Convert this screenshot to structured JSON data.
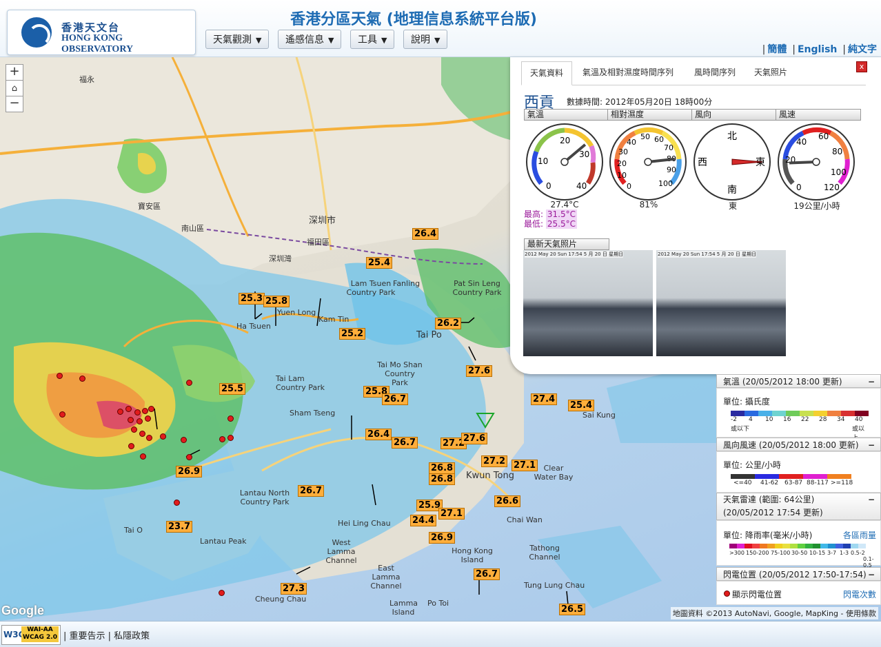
{
  "header": {
    "logo_zh": "香港天文台",
    "logo_en": "HONG KONG OBSERVATORY",
    "title": "香港分區天氣 (地理信息系統平台版)",
    "menus": [
      "天氣觀測",
      "遙感信息",
      "工具",
      "說明"
    ],
    "lang": [
      "簡體",
      "English",
      "純文字"
    ]
  },
  "map": {
    "zoom_in": "+",
    "zoom_out": "−",
    "places": [
      {
        "name": "福永",
        "big": false
      },
      {
        "name": "深圳市",
        "big": true
      },
      {
        "name": "福田區",
        "big": false
      },
      {
        "name": "南山區",
        "big": false
      },
      {
        "name": "寶安區",
        "big": false
      },
      {
        "name": "深圳灣",
        "big": false
      },
      {
        "name": "Tai Po",
        "big": false
      },
      {
        "name": "Fanling",
        "big": false
      },
      {
        "name": "Kwun Tong",
        "big": true
      },
      {
        "name": "Hong Kong Island",
        "big": false
      },
      {
        "name": "Lantau Peak",
        "big": false
      },
      {
        "name": "Tai O",
        "big": false
      },
      {
        "name": "Chai Wan",
        "big": false
      },
      {
        "name": "Sai Kung",
        "big": false
      },
      {
        "name": "Lamma Island",
        "big": false
      },
      {
        "name": "Clear Water Bay",
        "big": false
      },
      {
        "name": "Ha Tsuen",
        "big": false
      },
      {
        "name": "Kam Tin",
        "big": false
      },
      {
        "name": "Yuen Long",
        "big": false
      },
      {
        "name": "Tai Lam Country Park",
        "big": false
      },
      {
        "name": "Sham Tseng",
        "big": false
      },
      {
        "name": "Lam Tsuen Country Park",
        "big": false
      },
      {
        "name": "Tai Mo Shan Country Park",
        "big": false
      },
      {
        "name": "Pat Sin Leng Country Park",
        "big": false
      },
      {
        "name": "West Lamma Channel",
        "big": false
      },
      {
        "name": "East Lamma Channel",
        "big": false
      },
      {
        "name": "Lantau North Country Park",
        "big": false
      },
      {
        "name": "Tathong Channel",
        "big": false
      },
      {
        "name": "Hei Ling Chau",
        "big": false
      },
      {
        "name": "Po Toi",
        "big": false
      },
      {
        "name": "Tung Lung Chau",
        "big": false
      },
      {
        "name": "Cheung Chau",
        "big": false
      }
    ],
    "temperatures": [
      "26.4",
      "25.4",
      "25.3",
      "25.8",
      "25.2",
      "26.2",
      "27.6",
      "25.5",
      "25.8",
      "26.7",
      "27.4",
      "25.4",
      "26.4",
      "26.7",
      "27.2",
      "27.6",
      "26.8",
      "26.8",
      "27.2",
      "27.1",
      "26.9",
      "26.7",
      "25.9",
      "24.4",
      "27.1",
      "26.6",
      "26.9",
      "23.7",
      "26.7",
      "27.3",
      "26.5"
    ],
    "google": "Google",
    "credit": "地圖資料 ©2013 AutoNavi, Google, MapKing - 使用條款"
  },
  "info": {
    "tabs": [
      "天氣資料",
      "氣溫及相對濕度時間序列",
      "風時間序列",
      "天氣照片"
    ],
    "close": "x",
    "station": "西貢",
    "data_time": "數據時間: 2012年05月20日 18時00分",
    "gauges": [
      {
        "title": "氣溫",
        "value": "27.4°C",
        "ticks": [
          "0",
          "10",
          "20",
          "30",
          "40"
        ]
      },
      {
        "title": "相對濕度",
        "value": "81%",
        "ticks": [
          "0",
          "10",
          "20",
          "30",
          "40",
          "50",
          "60",
          "70",
          "80",
          "90",
          "100"
        ]
      },
      {
        "title": "風向",
        "value": "東",
        "ticks": [
          "北",
          "西",
          "東",
          "南"
        ]
      },
      {
        "title": "風速",
        "value": "19公里/小時",
        "ticks": [
          "0",
          "20",
          "40",
          "60",
          "80",
          "100",
          "120"
        ]
      }
    ],
    "temp_value": 27.4,
    "rh_value": 81,
    "wind_dir_deg": 90,
    "wind_speed_value": 19,
    "max_label": "最高:",
    "max_value": "31.5°C",
    "min_label": "最低:",
    "min_value": "25.5°C",
    "photo_title": "最新天氣照片",
    "photo_stamp": "2012 May 20 Sun 17:54 5 月 20 日 星期日"
  },
  "legend": {
    "temp_title": "氣溫 (20/05/2012 18:00 更新)",
    "temp_unit": "單位: 攝氏度",
    "temp_ticks": [
      "-2",
      "4",
      "10",
      "16",
      "22",
      "28",
      "34",
      "40"
    ],
    "temp_low": "或以下",
    "temp_high": "或以上",
    "wind_title": "風向風速 (20/05/2012 18:00 更新)",
    "wind_unit": "單位: 公里/小時",
    "wind_ticks": [
      "<=40",
      "41-62",
      "63-87",
      "88-117",
      ">=118"
    ],
    "radar_title": "天氣雷達 (範圍: 64公里)",
    "radar_time": "(20/05/2012 17:54 更新)",
    "radar_unit": "單位: 降雨率(毫米/小時)",
    "radar_link": "各區雨量",
    "radar_ticks": [
      ">300",
      "150-200",
      "75-100",
      "30-50",
      "10-15",
      "3-7",
      "1-3",
      "0.5-2",
      "0.1-0.5"
    ],
    "lightning_title": "閃電位置 (20/05/2012 17:50-17:54)",
    "lightning_show": "顯示閃電位置",
    "lightning_link": "閃電次數",
    "minimize": "−"
  },
  "footer": {
    "w3c": "W3C",
    "wai": "WAI-AA WCAG 2.0",
    "links": "| 重要告示 | 私隱政策"
  },
  "colors": {
    "brand_blue": "#1d6bb3",
    "temp_label_bg": "#ffae3b",
    "lightning": "#e11c1c"
  }
}
